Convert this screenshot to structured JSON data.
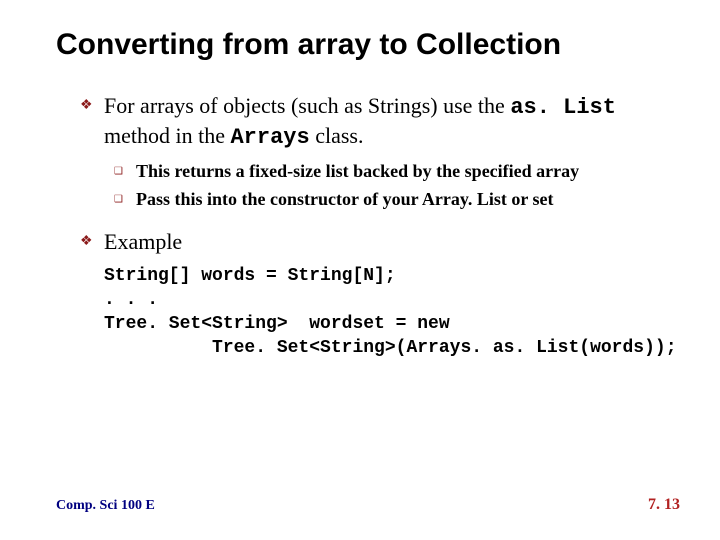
{
  "title": "Converting from array to Collection",
  "bullets": [
    {
      "text_pre": "For arrays of objects (such as Strings) use the ",
      "code1": "as. List",
      "text_mid": " method in the ",
      "code2": "Arrays",
      "text_post": " class.",
      "subs": [
        "This returns a fixed-size list backed by the specified array",
        "Pass this into the constructor of your Array. List or set"
      ]
    },
    {
      "text_pre": "Example",
      "code1": "",
      "text_mid": "",
      "code2": "",
      "text_post": ""
    }
  ],
  "code": "String[] words = String[N];\n. . .\nTree. Set<String>  wordset = new\n          Tree. Set<String>(Arrays. as. List(words));",
  "footer_left": "Comp. Sci 100 E",
  "footer_right": "7. 13"
}
